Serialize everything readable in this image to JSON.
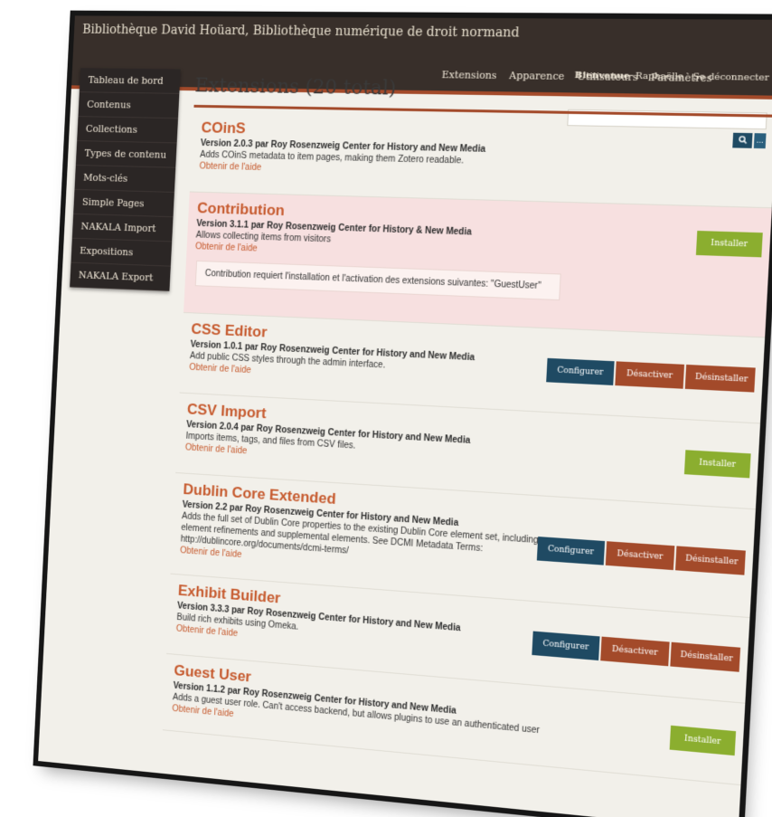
{
  "header": {
    "site_name": "Bibliothèque David Hoüard",
    "separator": ",",
    "site_subtitle": "Bibliothèque numérique de droit normand",
    "nav": [
      "Extensions",
      "Apparence",
      "Utilisateurs",
      "Paramètres"
    ],
    "welcome": "Bienvenue",
    "user": "Raphaëlle",
    "logout": "Se déconnecter"
  },
  "sidebar": {
    "items": [
      {
        "label": "Tableau de bord"
      },
      {
        "label": "Contenus"
      },
      {
        "label": "Collections"
      },
      {
        "label": "Types de contenu"
      },
      {
        "label": "Mots-clés"
      },
      {
        "label": "Simple Pages"
      },
      {
        "label": "NAKALA Import"
      },
      {
        "label": "Expositions"
      },
      {
        "label": "NAKALA Export"
      }
    ]
  },
  "search": {
    "placeholder": "",
    "button_icon": "search-icon",
    "options_label": "..."
  },
  "main": {
    "title": "Extensions (20 total)"
  },
  "buttons": {
    "configure": "Configurer",
    "deactivate": "Désactiver",
    "uninstall": "Désinstaller",
    "install": "Installer"
  },
  "help_label": "Obtenir de l'aide",
  "extensions": [
    {
      "name": "COinS",
      "version": "Version 2.0.3 par Roy Rosenzweig Center for History and New Media",
      "description": "Adds COinS metadata to item pages, making them Zotero readable.",
      "state": "active"
    },
    {
      "name": "Contribution",
      "version": "Version 3.1.1 par Roy Rosenzweig Center for History & New Media",
      "description": "Allows collecting items from visitors",
      "notice": "Contribution requiert l'installation et l'activation des extensions suivantes: \"GuestUser\"",
      "state": "install"
    },
    {
      "name": "CSS Editor",
      "version": "Version 1.0.1 par Roy Rosenzweig Center for History and New Media",
      "description": "Add public CSS styles through the admin interface.",
      "state": "active"
    },
    {
      "name": "CSV Import",
      "version": "Version 2.0.4 par Roy Rosenzweig Center for History and New Media",
      "description": "Imports items, tags, and files from CSV files.",
      "state": "install"
    },
    {
      "name": "Dublin Core Extended",
      "version": "Version 2.2 par Roy Rosenzweig Center for History and New Media",
      "description": "Adds the full set of Dublin Core properties to the existing Dublin Core element set, including element refinements and supplemental elements. See DCMI Metadata Terms: http://dublincore.org/documents/dcmi-terms/",
      "state": "active"
    },
    {
      "name": "Exhibit Builder",
      "version": "Version 3.3.3 par Roy Rosenzweig Center for History and New Media",
      "description": "Build rich exhibits using Omeka.",
      "state": "active"
    },
    {
      "name": "Guest User",
      "version": "Version 1.1.2 par Roy Rosenzweig Center for History and New Media",
      "description": "Adds a guest user role. Can't access backend, but allows plugins to use an authenticated user",
      "state": "install"
    }
  ]
}
